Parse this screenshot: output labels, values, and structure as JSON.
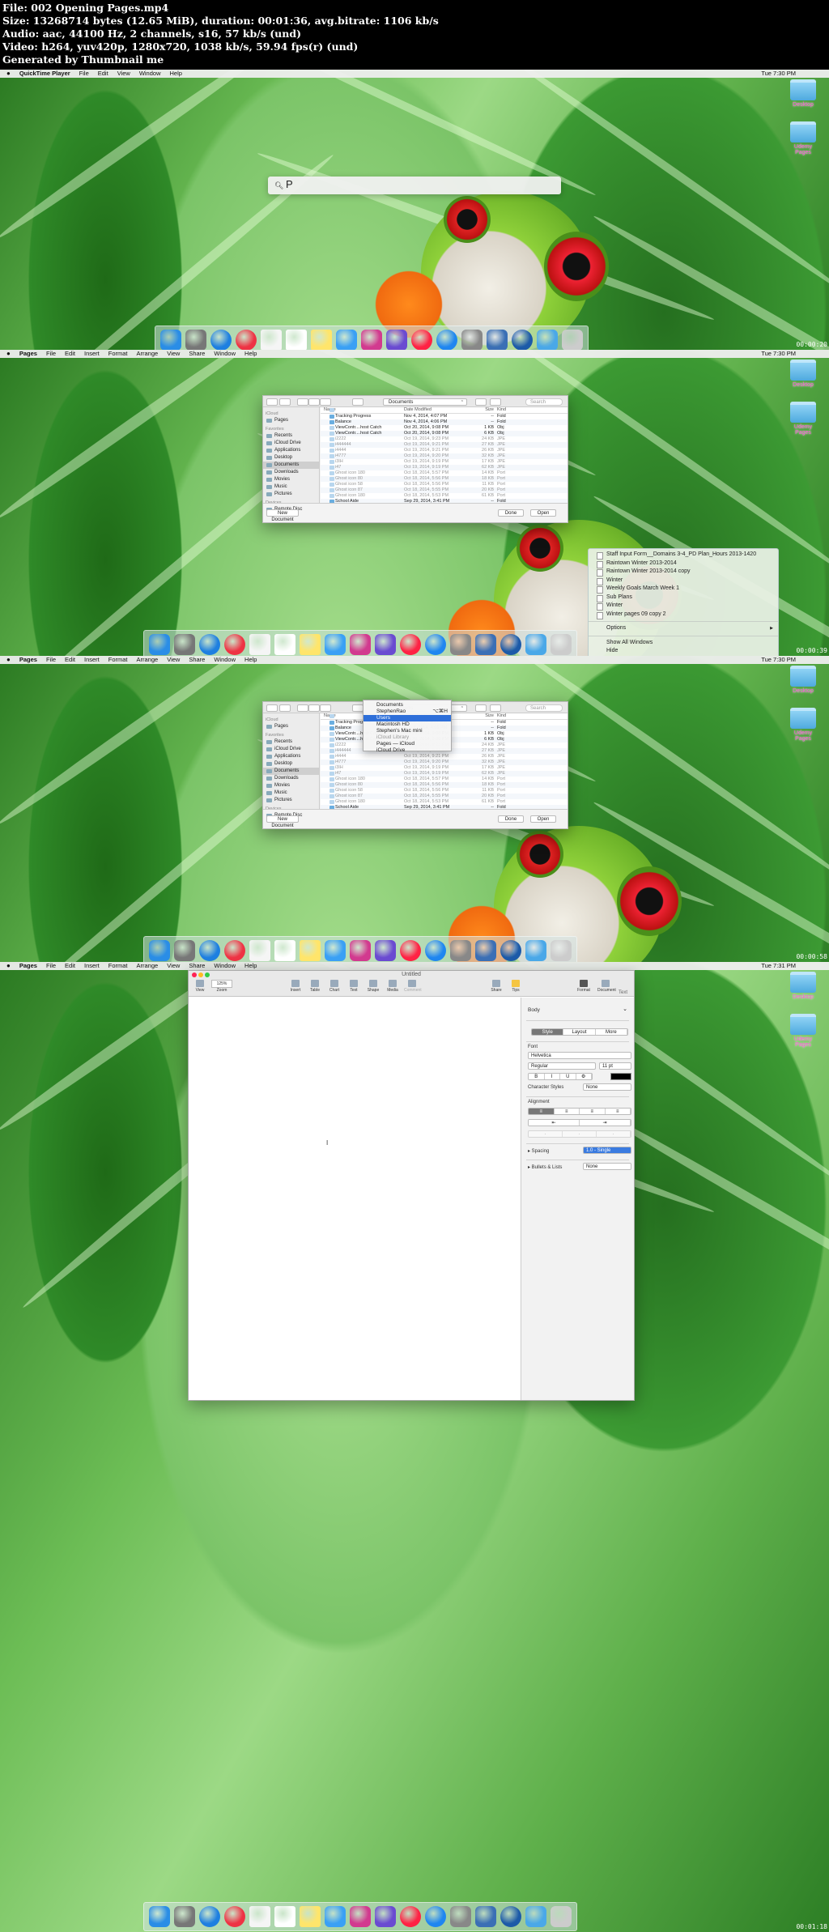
{
  "header": {
    "file": "File: 002 Opening Pages.mp4",
    "size": "Size: 13268714 bytes (12.65 MiB), duration: 00:01:36, avg.bitrate: 1106 kb/s",
    "audio": "Audio: aac, 44100 Hz, 2 channels, s16, 57 kb/s (und)",
    "video": "Video: h264, yuv420p, 1280x720, 1038 kb/s, 59.94 fps(r) (und)",
    "generated": "Generated by Thumbnail me"
  },
  "frames": [
    {
      "menubar": {
        "app": "QuickTime Player",
        "items": [
          "File",
          "Edit",
          "View",
          "Window",
          "Help"
        ],
        "clock": "Tue 7:30 PM"
      },
      "spotlight": {
        "query": "P"
      },
      "timestamp": "00:00:20",
      "desktop_icons": [
        "Desktop",
        "Udemy Pages"
      ]
    },
    {
      "menubar": {
        "app": "Pages",
        "items": [
          "File",
          "Edit",
          "Insert",
          "Format",
          "Arrange",
          "View",
          "Share",
          "Window",
          "Help"
        ],
        "clock": "Tue 7:30 PM"
      },
      "timestamp": "00:00:39",
      "desktop_icons": [
        "Desktop",
        "Udemy Pages"
      ]
    },
    {
      "menubar": {
        "app": "Pages",
        "items": [
          "File",
          "Edit",
          "Insert",
          "Format",
          "Arrange",
          "View",
          "Share",
          "Window",
          "Help"
        ],
        "clock": "Tue 7:30 PM"
      },
      "timestamp": "00:00:58",
      "desktop_icons": [
        "Desktop",
        "Udemy Pages"
      ]
    },
    {
      "menubar": {
        "app": "Pages",
        "items": [
          "File",
          "Edit",
          "Insert",
          "Format",
          "Arrange",
          "View",
          "Share",
          "Window",
          "Help"
        ],
        "clock": "Tue 7:31 PM"
      },
      "timestamp": "00:01:18",
      "desktop_icons": [
        "Desktop",
        "Udemy Pages"
      ]
    }
  ],
  "open_dialog": {
    "location": "Documents",
    "search_placeholder": "Search",
    "sidebar": [
      {
        "type": "h",
        "label": "iCloud"
      },
      {
        "type": "i",
        "label": "Pages"
      },
      {
        "type": "h",
        "label": "Favorites"
      },
      {
        "type": "i",
        "label": "Recents"
      },
      {
        "type": "i",
        "label": "iCloud Drive"
      },
      {
        "type": "i",
        "label": "Applications"
      },
      {
        "type": "i",
        "label": "Desktop"
      },
      {
        "type": "i",
        "label": "Documents",
        "sel": true
      },
      {
        "type": "i",
        "label": "Downloads"
      },
      {
        "type": "i",
        "label": "Movies"
      },
      {
        "type": "i",
        "label": "Music"
      },
      {
        "type": "i",
        "label": "Pictures"
      },
      {
        "type": "h",
        "label": "Devices"
      },
      {
        "type": "i",
        "label": "Remote Disc"
      }
    ],
    "columns": [
      "Name",
      "Date Modified",
      "Size",
      "Kind"
    ],
    "rows": [
      [
        "Tracking Progress",
        "Nov 4, 2014, 4:07 PM",
        "--",
        "Fold",
        "folder"
      ],
      [
        "Balance",
        "Nov 4, 2014, 4:06 PM",
        "--",
        "Fold",
        "folder"
      ],
      [
        "ViewContr....host Catch",
        "Oct 20, 2014, 9:08 PM",
        "1 KB",
        "Obj",
        ""
      ],
      [
        "ViewContr....host Catch",
        "Oct 20, 2014, 9:08 PM",
        "6 KB",
        "Obj",
        ""
      ],
      [
        "i2222",
        "Oct 19, 2014, 9:23 PM",
        "24 KB",
        "JPE",
        "grey"
      ],
      [
        "i444444",
        "Oct 19, 2014, 9:21 PM",
        "27 KB",
        "JPE",
        "grey"
      ],
      [
        "i4444",
        "Oct 19, 2014, 9:21 PM",
        "26 KB",
        "JPE",
        "grey"
      ],
      [
        "i4777",
        "Oct 19, 2014, 9:20 PM",
        "32 KB",
        "JPE",
        "grey"
      ],
      [
        "i3IH",
        "Oct 19, 2014, 9:19 PM",
        "17 KB",
        "JPE",
        "grey"
      ],
      [
        "i47",
        "Oct 19, 2014, 9:19 PM",
        "62 KB",
        "JPE",
        "grey"
      ],
      [
        "Ghost icon 180",
        "Oct 18, 2014, 5:57 PM",
        "14 KB",
        "Port",
        "grey"
      ],
      [
        "Ghost icon 80",
        "Oct 18, 2014, 5:56 PM",
        "18 KB",
        "Port",
        "grey"
      ],
      [
        "Ghost icon 58",
        "Oct 18, 2014, 5:56 PM",
        "11 KB",
        "Port",
        "grey"
      ],
      [
        "Ghost icon 87",
        "Oct 18, 2014, 5:55 PM",
        "20 KB",
        "Port",
        "grey"
      ],
      [
        "Ghost icon 180",
        "Oct 18, 2014, 5:53 PM",
        "61 KB",
        "Port",
        "grey"
      ],
      [
        "School Aide",
        "Sep 29, 2014, 3:41 PM",
        "--",
        "Fold",
        "folder"
      ],
      [
        "Flappy Bird",
        "Sep 28, 2014, 10:49 AM",
        "--",
        "Fold",
        "folder"
      ],
      [
        "Learning Swift",
        "Sep 20, 2014, 12:08 PM",
        "--",
        "Fold",
        "folder"
      ]
    ],
    "new_doc": "New Document",
    "done": "Done",
    "open": "Open"
  },
  "context_menu": {
    "docs": [
      "Staff Input Form__Domains 3-4_PD Plan_Hours 2013-1420",
      "Raintown Winter 2013-2014",
      "Raintown Winter 2013-2014 copy",
      "Winter",
      "Weekly Goals March Week 1",
      "Sub Plans",
      "Winter",
      "Winter pages 09 copy 2"
    ],
    "options": "Options",
    "show_all": "Show All Windows",
    "hide": "Hide",
    "quit": "Quit"
  },
  "location_popup": {
    "items": [
      {
        "label": "Documents",
        "cls": ""
      },
      {
        "label": "StephenRao",
        "cls": "",
        "kb": "⌥⌘H"
      },
      {
        "label": "Users",
        "cls": "sel"
      },
      {
        "label": "Macintosh HD",
        "cls": ""
      },
      {
        "label": "Stephen's Mac mini",
        "cls": ""
      },
      {
        "label": "iCloud Library",
        "cls": "grey"
      },
      {
        "label": "Pages — iCloud",
        "cls": ""
      },
      {
        "label": "iCloud Drive",
        "cls": ""
      }
    ]
  },
  "pages_window": {
    "title": "Untitled",
    "toolbar_left": [
      "View",
      "Zoom"
    ],
    "zoom": "125%",
    "toolbar_mid": [
      "Insert",
      "Table",
      "Chart",
      "Text",
      "Shape",
      "Media",
      "Comment"
    ],
    "toolbar_right": [
      "Share",
      "Tips",
      "Format",
      "Document"
    ],
    "inspector": {
      "header": "Text",
      "para_style": "Body",
      "tabs": [
        "Style",
        "Layout",
        "More"
      ],
      "font_label": "Font",
      "font": "Helvetica",
      "weight": "Regular",
      "size": "11 pt",
      "bius": [
        "B",
        "I",
        "U",
        "⚙"
      ],
      "char_styles_label": "Character Styles",
      "char_styles": "None",
      "alignment_label": "Alignment",
      "spacing_label": "Spacing",
      "spacing": "1.0 - Single",
      "bullets_label": "Bullets & Lists",
      "bullets": "None"
    }
  },
  "colors": {
    "menubar": "#eeeeee",
    "leaf": "#6cbd55",
    "selection": "#2e6fd9"
  },
  "dock_icons": [
    "finder-icon",
    "launchpad-icon",
    "safari-icon",
    "chrome-icon",
    "calendar-icon",
    "notes-icon",
    "stickies-icon",
    "messages-icon",
    "heart-icon",
    "imovie-icon",
    "itunes-icon",
    "appstore-icon",
    "system-prefs-icon",
    "xcode-icon",
    "quicktime-icon",
    "downloads-icon",
    "trash-icon"
  ]
}
